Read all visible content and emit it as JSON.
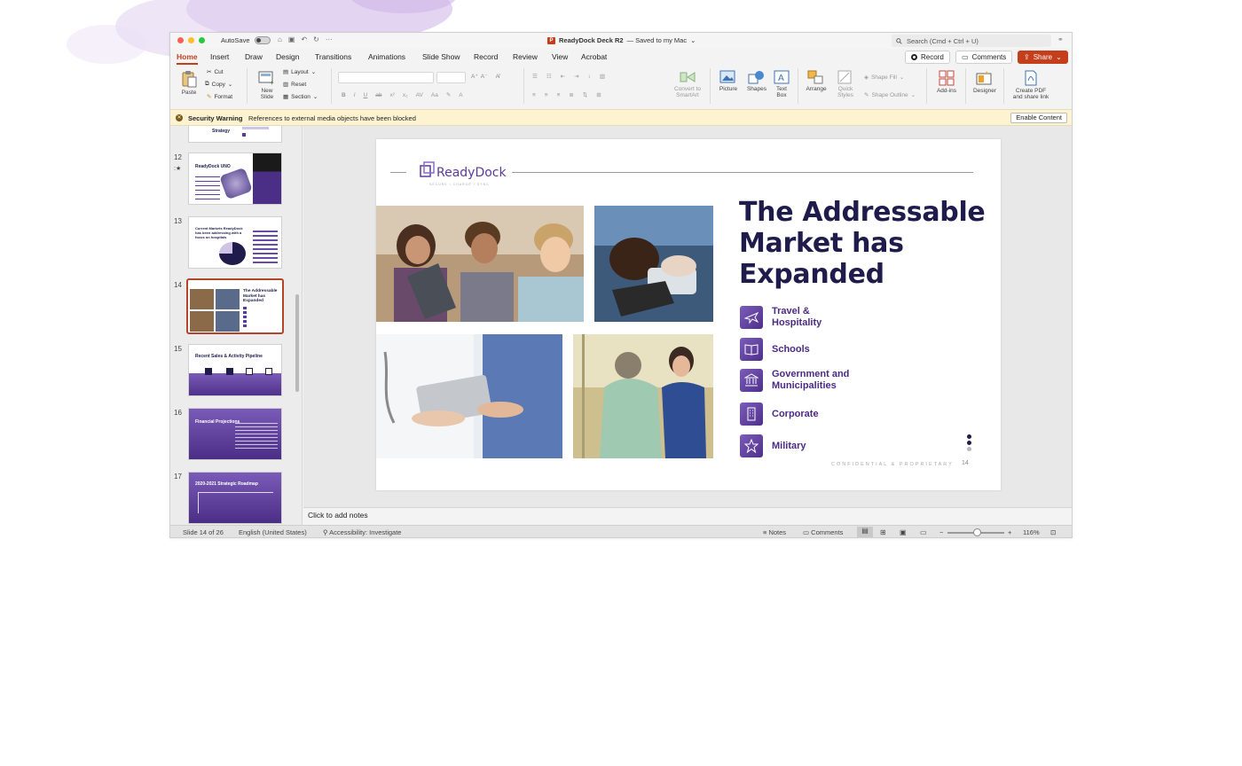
{
  "window": {
    "autosave_label": "AutoSave",
    "doc_title": "ReadyDock Deck R2",
    "save_state": "— Saved to my Mac",
    "search_placeholder": "Search (Cmd + Ctrl + U)"
  },
  "tabs": [
    "Home",
    "Insert",
    "Draw",
    "Design",
    "Transitions",
    "Animations",
    "Slide Show",
    "Record",
    "Review",
    "View",
    "Acrobat"
  ],
  "actions": {
    "record": "Record",
    "comments": "Comments",
    "share": "Share"
  },
  "ribbon": {
    "paste": "Paste",
    "cut": "Cut",
    "copy": "Copy",
    "format": "Format",
    "new_slide_1": "New",
    "new_slide_2": "Slide",
    "layout": "Layout",
    "reset": "Reset",
    "section": "Section",
    "convert_1": "Convert to",
    "convert_2": "SmartArt",
    "picture": "Picture",
    "shapes": "Shapes",
    "text_box_1": "Text",
    "text_box_2": "Box",
    "arrange": "Arrange",
    "quick_styles_1": "Quick",
    "quick_styles_2": "Styles",
    "shape_fill": "Shape Fill",
    "shape_outline": "Shape Outline",
    "add_ins": "Add-ins",
    "designer": "Designer",
    "create_pdf_1": "Create PDF",
    "create_pdf_2": "and share link"
  },
  "warning": {
    "title": "Security Warning",
    "message": "References to external media objects have been blocked",
    "button": "Enable Content"
  },
  "thumbnails": [
    {
      "num": "",
      "title": "Strategy"
    },
    {
      "num": "12",
      "title": "ReadyDock UNO"
    },
    {
      "num": "13",
      "title": "Current Markets ReadyDock has been addressing with a focus on hospitals"
    },
    {
      "num": "14",
      "title": "The Addressable Market has Expanded"
    },
    {
      "num": "15",
      "title": "Recent Sales & Activity Pipeline"
    },
    {
      "num": "16",
      "title": "Financial Projections"
    },
    {
      "num": "17",
      "title": "2020-2021 Strategic Roadmap"
    }
  ],
  "slide": {
    "logo_text": "ReadyDock",
    "logo_tagline": "SECURE • CHARGE • SYNC",
    "title_line1": "The Addressable",
    "title_line2": "Market has",
    "title_line3": "Expanded",
    "items": [
      {
        "line1": "Travel &",
        "line2": "Hospitality",
        "icon": "airplane-icon"
      },
      {
        "line1": "Schools",
        "line2": "",
        "icon": "book-icon"
      },
      {
        "line1": "Government and",
        "line2": "Municipalities",
        "icon": "government-building-icon"
      },
      {
        "line1": "Corporate",
        "line2": "",
        "icon": "office-building-icon"
      },
      {
        "line1": "Military",
        "line2": "",
        "icon": "star-icon"
      }
    ],
    "footer": "CONFIDENTIAL & PROPRIETARY",
    "page": "14"
  },
  "notes_placeholder": "Click to add notes",
  "status": {
    "slide_count": "Slide 14 of 26",
    "language": "English (United States)",
    "accessibility": "Accessibility: Investigate",
    "notes": "Notes",
    "comments": "Comments",
    "zoom": "116%"
  },
  "colors": {
    "accent": "#c43e1c",
    "title_navy": "#1f1c4c",
    "brand_purple": "#5b3a9b"
  }
}
